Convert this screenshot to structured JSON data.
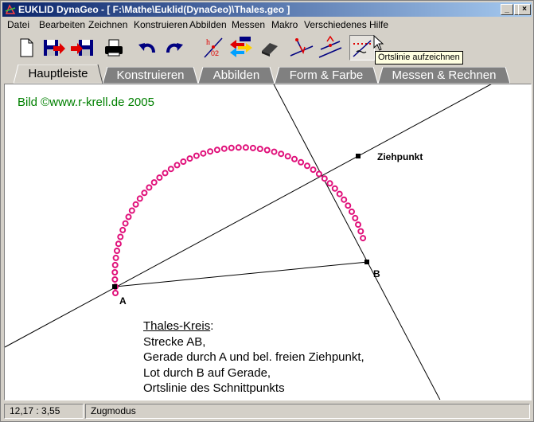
{
  "window": {
    "title": "EUKLID DynaGeo - [ F:\\Mathe\\Euklid(DynaGeo)\\Thales.geo ]",
    "minimize_glyph": "_",
    "maximize_glyph": "□",
    "close_glyph": "×"
  },
  "menu": [
    "Datei",
    "Bearbeiten",
    "Zeichnen",
    "Konstruieren",
    "Abbilden",
    "Messen",
    "Makro",
    "Verschiedenes",
    "Hilfe"
  ],
  "toolbar": {
    "tools": [
      "new-file-icon",
      "save-export-icon",
      "save-import-icon",
      "print-icon",
      "undo-icon",
      "redo-icon",
      "bisector-icon",
      "color-arrows-icon",
      "eraser-icon",
      "perpendicular-icon",
      "parallel-icon",
      "locus-icon"
    ],
    "tooltip": "Ortslinie aufzeichnen"
  },
  "tabs": [
    "Hauptleiste",
    "Konstruieren",
    "Abbilden",
    "Form & Farbe",
    "Messen & Rechnen"
  ],
  "active_tab": 0,
  "canvas": {
    "credit": "Bild ©www.r-krell.de  2005",
    "point_a": "A",
    "point_b": "B",
    "drag_point": "Ziehpunkt",
    "description": {
      "heading": "Thales-Kreis",
      "heading_suffix": ":",
      "lines": [
        "Strecke AB,",
        "Gerade durch A und bel. freien Ziehpunkt,",
        "Lot durch B auf Gerade,",
        "Ortslinie des Schnittpunkts"
      ]
    },
    "locus_color": "#e0107a",
    "credit_color": "#008000"
  },
  "status": {
    "coords": "12,17 : 3,55",
    "mode": "Zugmodus"
  }
}
